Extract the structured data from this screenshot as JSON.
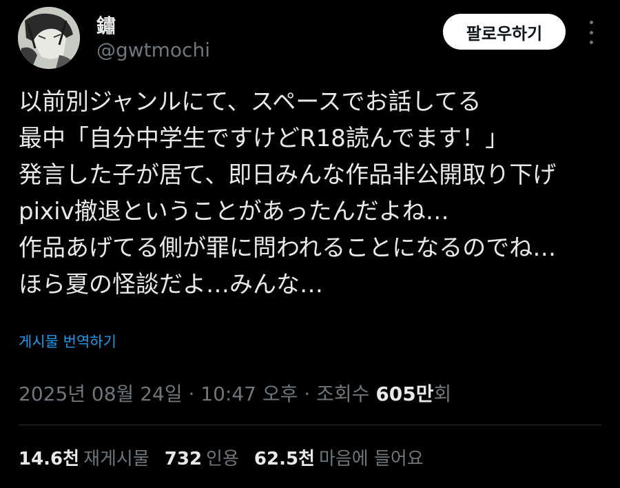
{
  "author": {
    "display_name": "鏽",
    "handle": "@gwtmochi"
  },
  "follow_button_label": "팔로우하기",
  "tweet_lines": [
    "以前別ジャンルにて、スペースでお話してる",
    "最中「自分中学生ですけどR18読んでます！」",
    "発言した子が居て、即日みんな作品非公開取り下げ",
    "pixiv撤退ということがあったんだよね…",
    "作品あげてる側が罪に問われることになるのでね…",
    "ほら夏の怪談だよ…みんな…"
  ],
  "translate_label": "게시물 번역하기",
  "meta": {
    "timestamp": "2025년 08월 24일 · 10:47 오후",
    "separator": " · ",
    "views_label": "조회수 ",
    "views_count": "605만",
    "views_suffix": "회"
  },
  "stats": [
    {
      "count": "14.6천",
      "label": "재게시물"
    },
    {
      "count": "732",
      "label": "인용"
    },
    {
      "count": "62.5천",
      "label": "마음에 들어요"
    }
  ],
  "colors": {
    "background": "#000000",
    "text": "#e7e9ea",
    "secondary": "#71767b",
    "link": "#1d9bf0",
    "divider": "#2f3336"
  },
  "icons": {
    "more": "more-horizontal-icon"
  }
}
